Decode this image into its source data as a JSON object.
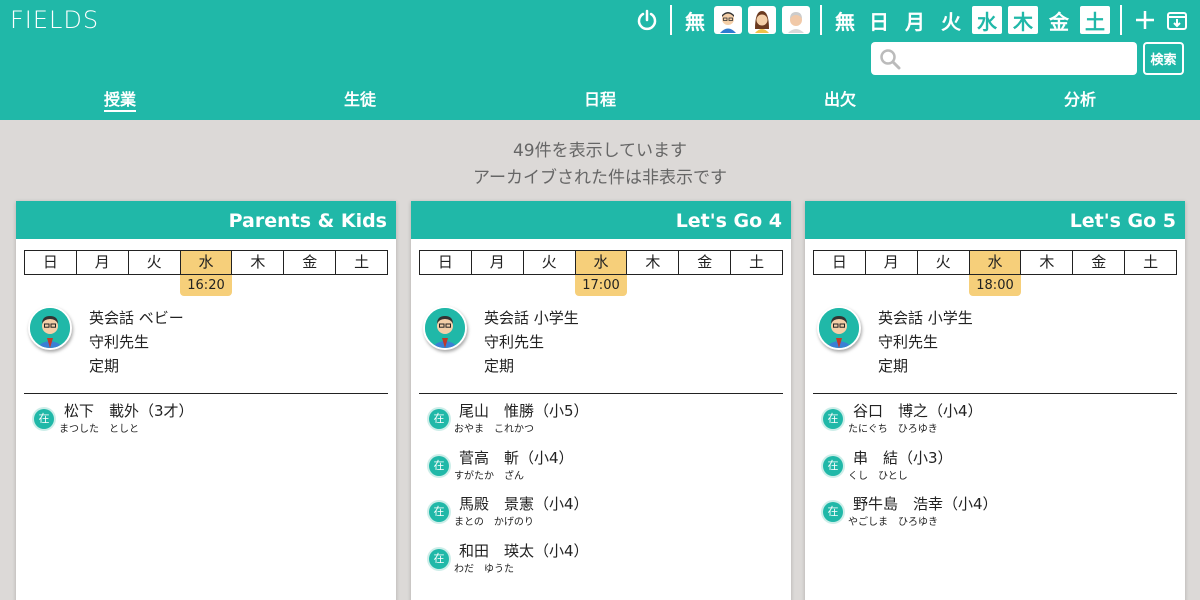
{
  "app": {
    "title": "FIELDS"
  },
  "toolbar": {
    "filter_none_label": "無",
    "days_none_label": "無",
    "days": [
      {
        "label": "日",
        "selected": false
      },
      {
        "label": "月",
        "selected": false
      },
      {
        "label": "火",
        "selected": false
      },
      {
        "label": "水",
        "selected": true
      },
      {
        "label": "木",
        "selected": true
      },
      {
        "label": "金",
        "selected": false
      },
      {
        "label": "土",
        "selected": true
      }
    ]
  },
  "search": {
    "placeholder": "",
    "value": "",
    "button_label": "検索"
  },
  "nav": [
    {
      "label": "授業",
      "active": true
    },
    {
      "label": "生徒",
      "active": false
    },
    {
      "label": "日程",
      "active": false
    },
    {
      "label": "出欠",
      "active": false
    },
    {
      "label": "分析",
      "active": false
    }
  ],
  "info": {
    "line1": "49件を表示しています",
    "line2": "アーカイブされた件は非表示です"
  },
  "weekdays": [
    "日",
    "月",
    "火",
    "水",
    "木",
    "金",
    "土"
  ],
  "cards": [
    {
      "title": "Parents & Kids",
      "time": "16:20",
      "course": "英会話 ベビー",
      "teacher": "守利先生",
      "type": "定期",
      "students": [
        {
          "status": "在",
          "name": "松下　載外（3才）",
          "kana": "まつした　としと"
        }
      ]
    },
    {
      "title": "Let's Go 4",
      "time": "17:00",
      "course": "英会話 小学生",
      "teacher": "守利先生",
      "type": "定期",
      "students": [
        {
          "status": "在",
          "name": "尾山　惟勝（小5）",
          "kana": "おやま　これかつ"
        },
        {
          "status": "在",
          "name": "菅高　斬（小4）",
          "kana": "すがたか　ざん"
        },
        {
          "status": "在",
          "name": "馬殿　景憲（小4）",
          "kana": "まとの　かげのり"
        },
        {
          "status": "在",
          "name": "和田　瑛太（小4）",
          "kana": "わだ　ゆうた"
        }
      ]
    },
    {
      "title": "Let's Go 5",
      "time": "18:00",
      "course": "英会話 小学生",
      "teacher": "守利先生",
      "type": "定期",
      "students": [
        {
          "status": "在",
          "name": "谷口　博之（小4）",
          "kana": "たにぐち　ひろゆき"
        },
        {
          "status": "在",
          "name": "串　結（小3）",
          "kana": "くし　ひとし"
        },
        {
          "status": "在",
          "name": "野牛島　浩幸（小4）",
          "kana": "やごしま　ひろゆき"
        }
      ]
    }
  ]
}
